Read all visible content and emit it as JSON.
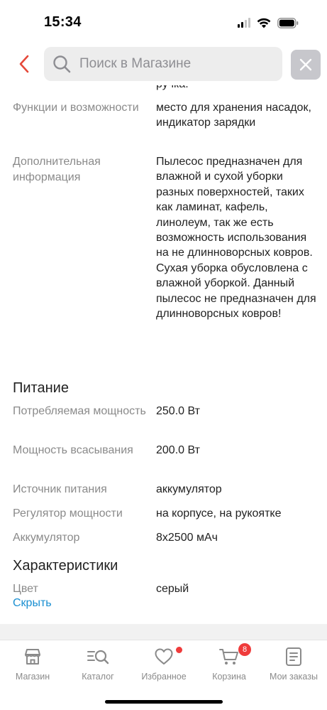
{
  "status_bar": {
    "time": "15:34"
  },
  "header": {
    "search_placeholder": "Поиск в Магазине"
  },
  "colors": {
    "accent": "#e5493a",
    "link": "#1a8fd1",
    "badge": "#ef3b3b"
  },
  "specs": {
    "cut_value": "ручка.",
    "functions": {
      "label": "Функции и возможности",
      "value": "место для хранения насадок, индикатор зарядки"
    },
    "extra": {
      "label": "Дополнительная информация",
      "value": "Пылесос предназначен для влажной и сухой уборки разных поверхностей, таких как ламинат, кафель, линолеум, так же есть возможность использования на не длинноворсных ковров. Сухая уборка обусловлена с влажной уборкой. Данный пылесос не предназначен для длинноворсных ковров!"
    }
  },
  "power_section": {
    "title": "Питание",
    "items": [
      {
        "label": "Потребляемая мощность",
        "value": "250.0 Вт"
      },
      {
        "label": "Мощность всасывания",
        "value": "200.0 Вт"
      },
      {
        "label": "Источник питания",
        "value": "аккумулятор"
      },
      {
        "label": "Регулятор мощности",
        "value": "на корпусе, на рукоятке"
      },
      {
        "label": "Аккумулятор",
        "value": "8x2500 мАч"
      }
    ]
  },
  "characteristics_section": {
    "title": "Характеристики",
    "items": [
      {
        "label": "Цвет",
        "value": "серый"
      }
    ],
    "hide_link": "Скрыть"
  },
  "tab_bar": {
    "tabs": [
      {
        "label": "Магазин",
        "icon": "store-icon"
      },
      {
        "label": "Каталог",
        "icon": "catalog-search-icon"
      },
      {
        "label": "Избранное",
        "icon": "heart-icon"
      },
      {
        "label": "Корзина",
        "icon": "cart-icon"
      },
      {
        "label": "Мои заказы",
        "icon": "orders-icon"
      }
    ],
    "cart_badge": "8"
  }
}
